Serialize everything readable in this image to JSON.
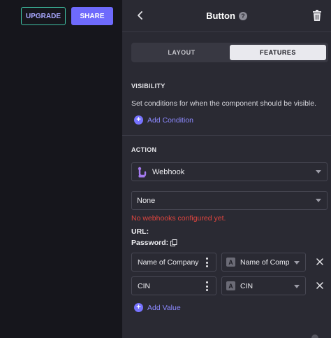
{
  "topbar": {
    "upgrade_label": "UPGRADE",
    "share_label": "SHARE"
  },
  "panel": {
    "title": "Button",
    "help_glyph": "?",
    "tabs": [
      {
        "label": "LAYOUT",
        "active": false
      },
      {
        "label": "FEATURES",
        "active": true
      }
    ],
    "visibility": {
      "title": "VISIBILITY",
      "description": "Set conditions for when the component should be visible.",
      "add_label": "Add Condition"
    },
    "action": {
      "title": "ACTION",
      "action_select": "Webhook",
      "webhook_select": "None",
      "error": "No webhooks configured yet.",
      "url_label": "URL:",
      "password_label": "Password:",
      "mappings": [
        {
          "key": "Name of Company",
          "value": "Name of Company"
        },
        {
          "key": "CIN",
          "value": "CIN"
        }
      ],
      "add_value_label": "Add Value"
    }
  },
  "colors": {
    "accent": "#6e6afc",
    "upgrade_border": "#3fc1a3",
    "error": "#e0453f",
    "panel_bg": "#2a2a33",
    "page_bg": "#16161c"
  },
  "icons": {
    "back": "chevron-left-icon",
    "help": "help-circle-icon",
    "trash": "trash-icon",
    "webhook": "webhook-icon",
    "copy": "copy-icon",
    "plus": "plus-circle-icon",
    "kebab": "more-vertical-icon",
    "text_type": "text-type-icon",
    "remove": "close-icon"
  }
}
